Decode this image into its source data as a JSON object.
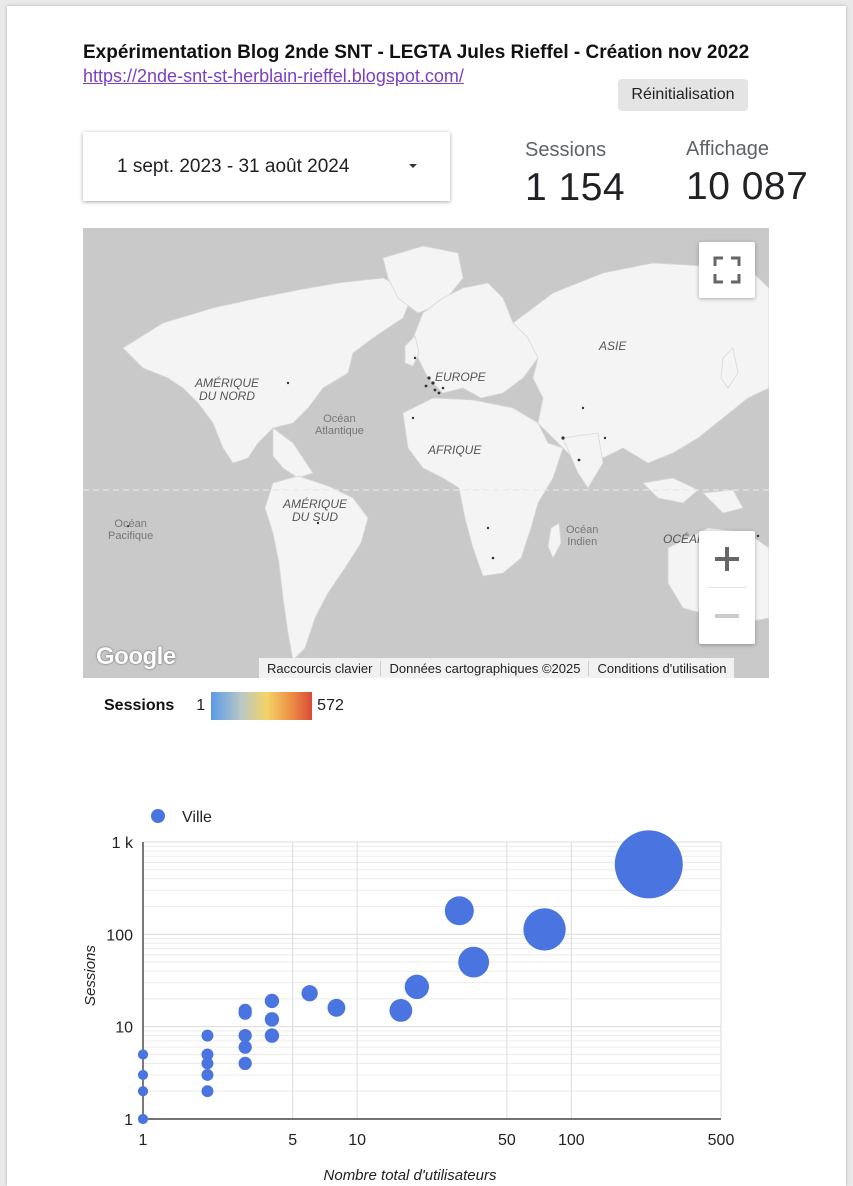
{
  "header": {
    "title": "Expérimentation Blog 2nde SNT - LEGTA Jules Rieffel - Création nov 2022",
    "link": "https://2nde-snt-st-herblain-rieffel.blogspot.com/",
    "reset_label": "Réinitialisation"
  },
  "date_range": {
    "value": "1 sept. 2023 - 31 août 2024"
  },
  "kpis": {
    "sessions": {
      "label": "Sessions",
      "value": "1 154"
    },
    "views": {
      "label": "Affichage",
      "value": "10 087"
    }
  },
  "map": {
    "continents": {
      "north_america": "AMÉRIQUE\nDU NORD",
      "europe": "EUROPE",
      "asia": "ASIE",
      "africa": "AFRIQUE",
      "south_america": "AMÉRIQUE\nDU SUD",
      "oceania": "OCÉANIE"
    },
    "oceans": {
      "atlantic": "Océan\nAtlantique",
      "pacific": "Océan\nPacifique",
      "indian": "Océan\nIndien"
    },
    "google_logo": "Google",
    "attribution": {
      "shortcuts": "Raccourcis clavier",
      "data": "Données cartographiques ©2025",
      "terms": "Conditions d'utilisation"
    },
    "icons": {
      "fullscreen": "fullscreen-icon",
      "zoom_in": "plus-icon",
      "zoom_out": "minus-icon"
    },
    "colors": {
      "land": "#f4f4f4",
      "water": "#c9c9c9"
    }
  },
  "color_legend": {
    "title": "Sessions",
    "min": "1",
    "max": "572",
    "colors": [
      "#5a9ae8",
      "#f2d468",
      "#d94b35"
    ]
  },
  "chart_data": {
    "type": "scatter",
    "legend": "Ville",
    "xlabel": "Nombre total d'utilisateurs",
    "ylabel": "Sessions",
    "xscale": "log",
    "yscale": "log",
    "xlim": [
      1,
      500
    ],
    "ylim": [
      1,
      1000
    ],
    "x_ticks": [
      "1",
      "5",
      "10",
      "50",
      "100",
      "500"
    ],
    "y_ticks": [
      "1",
      "10",
      "100",
      "1 k"
    ],
    "color": "#4a74e0",
    "points": [
      {
        "x": 1,
        "y": 1
      },
      {
        "x": 1,
        "y": 2
      },
      {
        "x": 1,
        "y": 3
      },
      {
        "x": 1,
        "y": 5
      },
      {
        "x": 2,
        "y": 2
      },
      {
        "x": 2,
        "y": 3
      },
      {
        "x": 2,
        "y": 4
      },
      {
        "x": 2,
        "y": 5
      },
      {
        "x": 2,
        "y": 8
      },
      {
        "x": 3,
        "y": 4
      },
      {
        "x": 3,
        "y": 6
      },
      {
        "x": 3,
        "y": 8
      },
      {
        "x": 3,
        "y": 14
      },
      {
        "x": 3,
        "y": 15
      },
      {
        "x": 4,
        "y": 8
      },
      {
        "x": 4,
        "y": 12
      },
      {
        "x": 4,
        "y": 19
      },
      {
        "x": 6,
        "y": 23
      },
      {
        "x": 8,
        "y": 16
      },
      {
        "x": 16,
        "y": 15
      },
      {
        "x": 19,
        "y": 27
      },
      {
        "x": 30,
        "y": 180
      },
      {
        "x": 35,
        "y": 50
      },
      {
        "x": 75,
        "y": 113
      },
      {
        "x": 230,
        "y": 572
      }
    ]
  }
}
